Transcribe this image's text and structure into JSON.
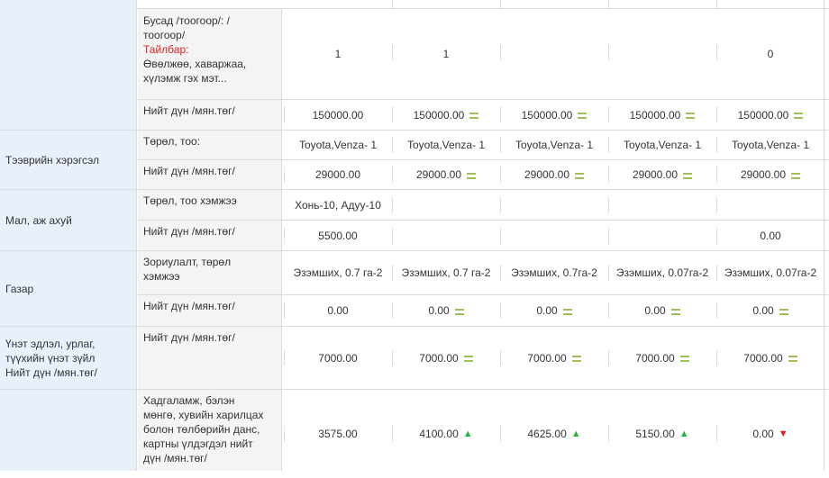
{
  "rows": {
    "busad": {
      "label_line1": "Бусад /тоогоор/: /",
      "label_line2": "тоогоор/",
      "note_label": "Тайлбар",
      "note_colon": ":",
      "note_line1": "Өвөлжөө, хаваржаа,",
      "note_line2": "хүлэмж гэх мэт...",
      "values": [
        "1",
        "1",
        "",
        "",
        "0"
      ]
    },
    "busad_total": {
      "label": "Нийт дүн /мян.төг/",
      "values": [
        "150000.00",
        "150000.00",
        "150000.00",
        "150000.00",
        "150000.00"
      ],
      "icons": [
        "none",
        "equal-icon",
        "equal-icon",
        "equal-icon",
        "equal-icon"
      ]
    },
    "vehicle": {
      "category": "Тээврийн хэрэгсэл",
      "type_label": "Төрөл, тоо:",
      "type_values": [
        "Toyota,Venza- 1",
        "Toyota,Venza- 1",
        "Toyota,Venza- 1",
        "Toyota,Venza- 1",
        "Toyota,Venza- 1"
      ],
      "total_label": "Нийт дүн /мян.төг/",
      "total_values": [
        "29000.00",
        "29000.00",
        "29000.00",
        "29000.00",
        "29000.00"
      ],
      "total_icons": [
        "none",
        "equal-icon",
        "equal-icon",
        "equal-icon",
        "equal-icon"
      ]
    },
    "livestock": {
      "category": "Мал, аж ахуй",
      "type_label": "Төрөл, тоо хэмжээ",
      "type_values": [
        "Хонь-10, Адуу-10",
        "",
        "",
        "",
        ""
      ],
      "total_label": "Нийт дүн /мян.төг/",
      "total_values": [
        "5500.00",
        "",
        "",
        "",
        "0.00"
      ]
    },
    "land": {
      "category": "Газар",
      "type_label_line1": "Зориулалт, төрөл",
      "type_label_line2": "хэмжээ",
      "type_values": [
        "Эзэмших, 0.7 га-2",
        "Эзэмших, 0.7 га-2",
        "Эзэмших, 0.7га-2",
        "Эзэмших, 0.07га-2",
        "Эзэмших, 0.07га-2"
      ],
      "total_label": "Нийт дүн /мян.төг/",
      "total_values": [
        "0.00",
        "0.00",
        "0.00",
        "0.00",
        "0.00"
      ],
      "total_icons": [
        "none",
        "equal-icon",
        "equal-icon",
        "equal-icon",
        "equal-icon"
      ]
    },
    "securities": {
      "category_line1": "Үнэт эдлэл, урлаг,",
      "category_line2": "түүхийн үнэт зүйл",
      "category_line3": "Нийт дүн /мян.төг/",
      "total_label": "Нийт дүн /мян.төг/",
      "total_values": [
        "7000.00",
        "7000.00",
        "7000.00",
        "7000.00",
        "7000.00"
      ],
      "total_icons": [
        "none",
        "equal-icon",
        "equal-icon",
        "equal-icon",
        "equal-icon"
      ]
    },
    "savings": {
      "label_line1": "Хадгаламж, бэлэн",
      "label_line2": "мөнгө, хувийн харилцах",
      "label_line3": "болон төлбөрийн данс,",
      "label_line4": "картны үлдэгдэл нийт",
      "label_line5": "дүн /мян.төг/",
      "values": [
        "3575.00",
        "4100.00",
        "4625.00",
        "5150.00",
        "0.00"
      ],
      "icons": [
        "none",
        "arrow-up-icon",
        "arrow-up-icon",
        "arrow-up-icon",
        "arrow-down-icon"
      ]
    }
  }
}
